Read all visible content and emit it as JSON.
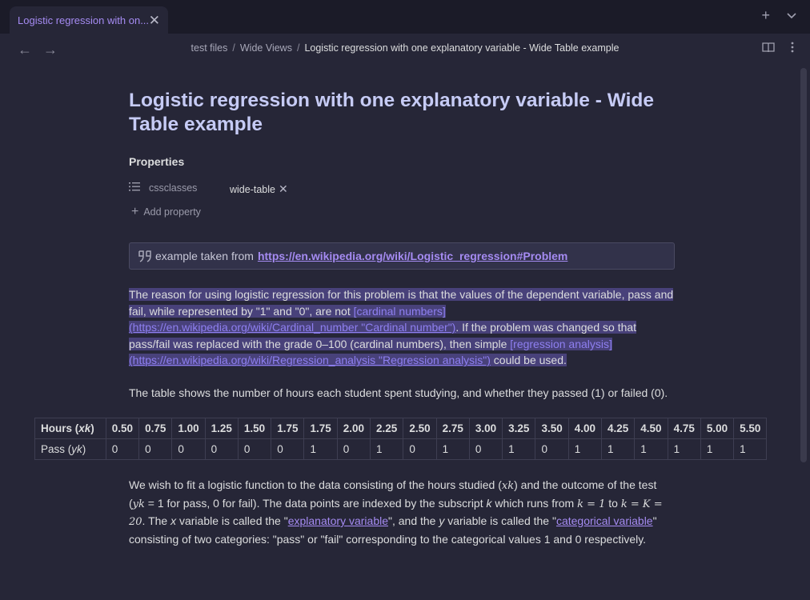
{
  "tab": {
    "title": "Logistic regression with on...",
    "close": "✕"
  },
  "tabbar": {
    "new_tab": "+",
    "menu": "⌄"
  },
  "nav": {
    "back": "←",
    "forward": "→"
  },
  "breadcrumb": {
    "parts": [
      "test files",
      "Wide Views",
      "Logistic regression with one explanatory variable - Wide Table example"
    ],
    "sep": "/"
  },
  "page": {
    "title": "Logistic regression with one explanatory variable - Wide Table example"
  },
  "properties": {
    "heading": "Properties",
    "items": [
      {
        "key": "cssclasses",
        "value": "wide-table",
        "remove": "✕"
      }
    ],
    "add_label": "Add property",
    "add_icon": "+"
  },
  "callout": {
    "prefix": "example taken from",
    "link": "https://en.wikipedia.org/wiki/Logistic_regression#Problem",
    "icon": "quote-icon"
  },
  "para1": {
    "t1": "The reason for using logistic regression for this problem is that the values of the dependent variable, pass and fail, while represented by \"1\" and \"0\", are not ",
    "l1_text": "[cardinal numbers]",
    "l1_url": "(https://en.wikipedia.org/wiki/Cardinal_number \"Cardinal number\")",
    "t2": ". If the problem was changed so that pass/fail was replaced with the grade 0–100 (cardinal numbers), then simple ",
    "l2_text": "[regression analysis]",
    "l2_url": "(https://en.wikipedia.org/wiki/Regression_analysis \"Regression analysis\")",
    "t3": " could be used."
  },
  "para2": "The table shows the number of hours each student spent studying, and whether they passed (1) or failed (0).",
  "table": {
    "header_label": "Hours (",
    "header_var": "xk",
    "header_close": ")",
    "row_label": "Pass (",
    "row_var": "yk",
    "row_close": ")",
    "hours": [
      "0.50",
      "0.75",
      "1.00",
      "1.25",
      "1.50",
      "1.75",
      "1.75",
      "2.00",
      "2.25",
      "2.50",
      "2.75",
      "3.00",
      "3.25",
      "3.50",
      "4.00",
      "4.25",
      "4.50",
      "4.75",
      "5.00",
      "5.50"
    ],
    "pass": [
      "0",
      "0",
      "0",
      "0",
      "0",
      "0",
      "1",
      "0",
      "1",
      "0",
      "1",
      "0",
      "1",
      "0",
      "1",
      "1",
      "1",
      "1",
      "1",
      "1"
    ]
  },
  "para3": {
    "t1": "We wish to fit a logistic function to the data consisting of the hours studied (",
    "m1": "xk",
    "t2": ") and the outcome of the test (",
    "m2": "yk",
    "t3": " = 1 for pass, 0 for fail). The data points are indexed by the subscript ",
    "k": "k",
    "t4": " which runs from ",
    "m3": "k = 1",
    "t5": " to ",
    "m4": "k = K = 20",
    "t6": ". The ",
    "x": "x",
    "t7": " variable is called the \"",
    "l1": "explanatory variable",
    "t8": "\", and the ",
    "y": "y",
    "t9": " variable is called the \"",
    "l2": "categorical variable",
    "t10": "\" consisting of two categories: \"pass\" or \"fail\" corresponding to the categorical values 1 and 0 respectively."
  },
  "colors": {
    "accent": "#a58bf2",
    "title": "#c6cbf5",
    "highlight": "#48417a",
    "background": "#262637"
  }
}
